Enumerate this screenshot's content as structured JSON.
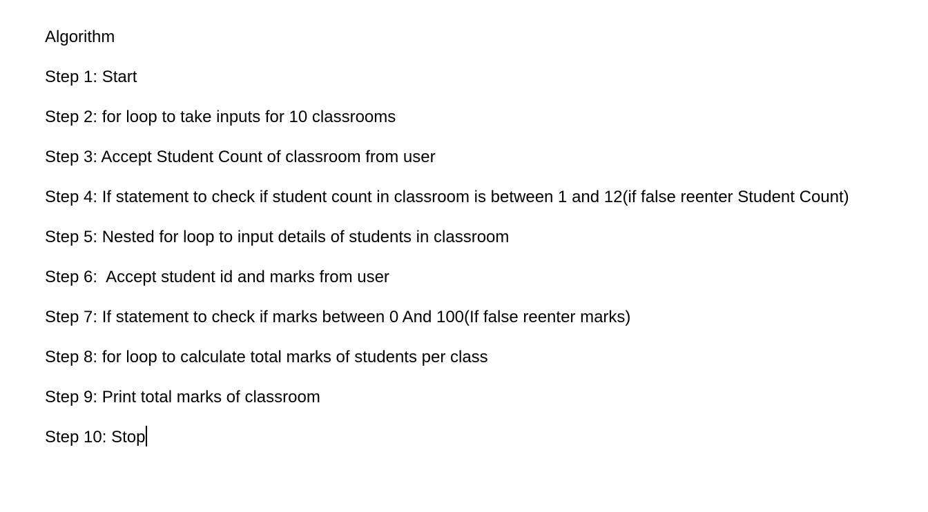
{
  "document": {
    "title": "Algorithm",
    "steps": [
      "Step 1: Start",
      "Step 2: for loop to take inputs for 10 classrooms",
      "Step 3: Accept Student Count of classroom from user",
      "Step 4: If statement to check if student count in classroom is between 1 and 12(if false reenter Student Count)",
      "Step 5: Nested for loop to input details of students in classroom",
      "Step 6:  Accept student id and marks from user",
      "Step 7: If statement to check if marks between 0 And 100(If false reenter marks)",
      "Step 8: for loop to calculate total marks of students per class",
      "Step 9: Print total marks of classroom",
      "Step 10: Stop"
    ]
  }
}
